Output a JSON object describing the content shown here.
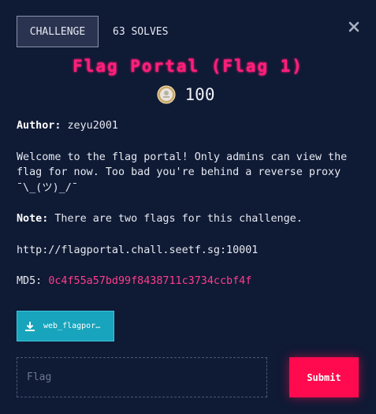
{
  "tabs": {
    "challenge_label": "CHALLENGE",
    "solves_label": "63 SOLVES"
  },
  "title": "Flag Portal (Flag 1)",
  "points": "100",
  "author": {
    "label": "Author:",
    "value": " zeyu2001"
  },
  "description": "Welcome to the flag portal! Only admins can view the flag for now. Too bad you're behind a reverse proxy ¯\\_(ツ)_/¯",
  "note": {
    "label": "Note:",
    "value": " There are two flags for this challenge."
  },
  "url": "http://flagportal.chall.seetf.sg:10001",
  "md5": {
    "label": "MD5:",
    "value": "0c4f55a57bd99f8438711c3734ccbf4f"
  },
  "download": {
    "label": "web_flagpor…"
  },
  "flag_input": {
    "placeholder": "Flag",
    "value": ""
  },
  "submit_label": "Submit",
  "colors": {
    "accent": "#ff1f7a",
    "submit": "#ff0a4e",
    "download": "#18a4bd",
    "background": "#0f1a35"
  },
  "icons": {
    "close": "close-icon",
    "coin": "coin-icon",
    "download": "download-icon"
  }
}
